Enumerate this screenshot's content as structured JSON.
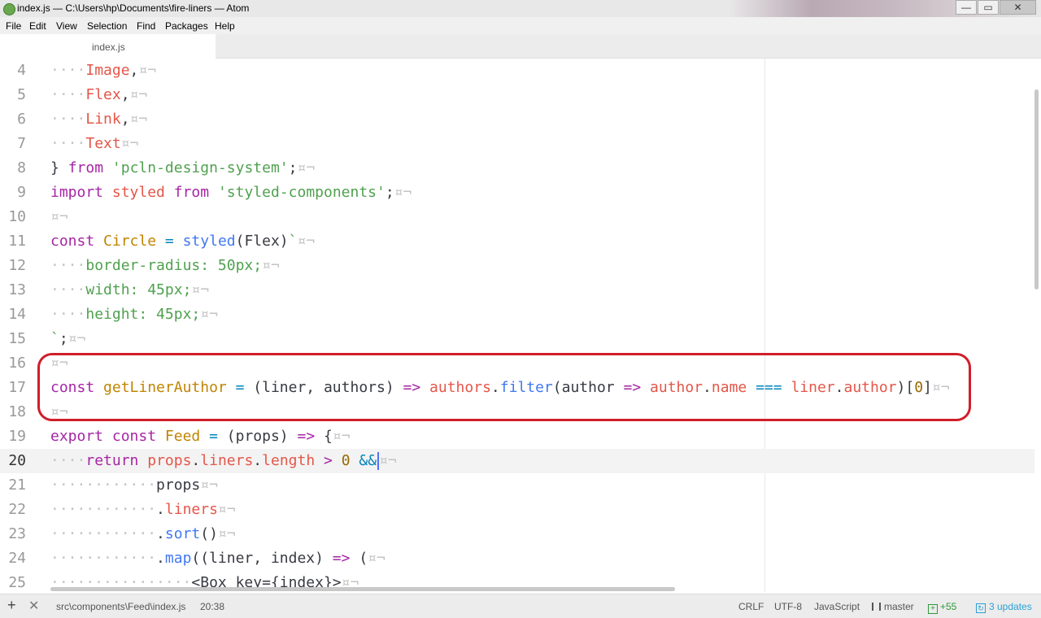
{
  "window": {
    "title": "index.js — C:\\Users\\hp\\Documents\\fire-liners — Atom",
    "controls": {
      "minimize": "—",
      "maximize": "▭",
      "close": "✕"
    }
  },
  "menu": [
    "File",
    "Edit",
    "View",
    "Selection",
    "Find",
    "Packages",
    "Help"
  ],
  "tabs": [
    {
      "label": "index.js",
      "active": true
    }
  ],
  "editor": {
    "current_line": "20",
    "lines": [
      {
        "n": "4",
        "ws": "····",
        "text": "Image,",
        "eol": "¤¬"
      },
      {
        "n": "5",
        "ws": "····",
        "text": "Flex,",
        "eol": "¤¬"
      },
      {
        "n": "6",
        "ws": "····",
        "text": "Link,",
        "eol": "¤¬"
      },
      {
        "n": "7",
        "ws": "····",
        "text": "Text",
        "eol": "¤¬"
      },
      {
        "n": "8",
        "ws": "",
        "text": "} from 'pcln-design-system';",
        "eol": "¤¬"
      },
      {
        "n": "9",
        "ws": "",
        "text": "import styled from 'styled-components';",
        "eol": "¤¬"
      },
      {
        "n": "10",
        "ws": "",
        "text": "",
        "eol": "¤¬"
      },
      {
        "n": "11",
        "ws": "",
        "text": "const Circle = styled(Flex)`",
        "eol": "¤¬"
      },
      {
        "n": "12",
        "ws": "····",
        "text": "border-radius: 50px;",
        "eol": "¤¬"
      },
      {
        "n": "13",
        "ws": "····",
        "text": "width: 45px;",
        "eol": "¤¬"
      },
      {
        "n": "14",
        "ws": "····",
        "text": "height: 45px;",
        "eol": "¤¬"
      },
      {
        "n": "15",
        "ws": "",
        "text": "`;",
        "eol": "¤¬"
      },
      {
        "n": "16",
        "ws": "",
        "text": "",
        "eol": "¤¬"
      },
      {
        "n": "17",
        "ws": "",
        "text": "const getLinerAuthor = (liner, authors) => authors.filter(author => author.name === liner.author)[0]",
        "eol": "¤¬"
      },
      {
        "n": "18",
        "ws": "",
        "text": "",
        "eol": "¤¬"
      },
      {
        "n": "19",
        "ws": "",
        "text": "export const Feed = (props) => {",
        "eol": "¤¬"
      },
      {
        "n": "20",
        "ws": "····",
        "text": "return props.liners.length > 0 &&",
        "eol": "¤¬"
      },
      {
        "n": "21",
        "ws": "············",
        "text": "props",
        "eol": "¤¬"
      },
      {
        "n": "22",
        "ws": "············",
        "text": ".liners",
        "eol": "¤¬"
      },
      {
        "n": "23",
        "ws": "············",
        "text": ".sort()",
        "eol": "¤¬"
      },
      {
        "n": "24",
        "ws": "············",
        "text": ".map((liner, index) => (",
        "eol": "¤¬"
      },
      {
        "n": "25",
        "ws": "················",
        "text": "<Box key={index}>",
        "eol": "¤¬"
      }
    ]
  },
  "status": {
    "file_path": "src\\components\\Feed\\index.js",
    "cursor_pos": "20:38",
    "line_ending": "CRLF",
    "encoding": "UTF-8",
    "grammar": "JavaScript",
    "branch": "master",
    "diff": "+55",
    "updates": "3 updates"
  },
  "colors": {
    "keyword": "#a626a4",
    "string": "#50a14f",
    "property": "#e45649",
    "function": "#4078f2",
    "class": "#c18401",
    "number": "#986801",
    "highlight_box": "#d01e2a"
  }
}
